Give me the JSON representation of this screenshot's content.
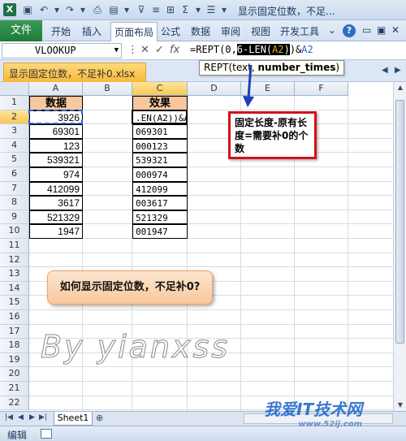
{
  "titlebar": {
    "app_icon": "X",
    "title": "显示固定位数，不足..."
  },
  "ribbon": {
    "file_tab": "文件",
    "tabs": [
      "开始",
      "插入",
      "页面布局",
      "公式",
      "数据",
      "审阅",
      "视图",
      "开发工具"
    ],
    "active_tab": "页面布局"
  },
  "formula_bar": {
    "name_box": "VLOOKUP",
    "formula_prefix": "=REPT(0,",
    "formula_highlight": "6-LEN(",
    "formula_highlight_ref": "A2",
    "formula_highlight_close": ")",
    "formula_suffix": ")&",
    "formula_suffix_ref": "A2",
    "tooltip_prefix": "REPT(text, ",
    "tooltip_bold": "number_times",
    "tooltip_suffix": ")"
  },
  "workbook_tab": "显示固定位数，不足补0.xlsx",
  "columns": [
    "A",
    "B",
    "C",
    "D",
    "E",
    "F"
  ],
  "rows": [
    "1",
    "2",
    "3",
    "4",
    "5",
    "6",
    "7",
    "8",
    "9",
    "10",
    "11",
    "12",
    "13",
    "14",
    "15",
    "16",
    "17",
    "18",
    "19",
    "20",
    "21",
    "22"
  ],
  "table": {
    "header_a": "数据",
    "header_c": "效果",
    "col_a": [
      "3926",
      "69301",
      "123",
      "539321",
      "974",
      "412099",
      "3617",
      "521329",
      "1947"
    ],
    "col_c": [
      ".EN(A2))&A",
      "069301",
      "000123",
      "539321",
      "000974",
      "412099",
      "003617",
      "521329",
      "001947"
    ]
  },
  "annotation": "固定长度-原有长度=需要补0的个数",
  "callout": "如何显示固定位数，不足补0?",
  "watermark": "By yianxss",
  "sheet_tab": "Sheet1",
  "status_mode": "编辑",
  "brand": "我爱IT技术网",
  "brand_sub": "www.52ij.com"
}
